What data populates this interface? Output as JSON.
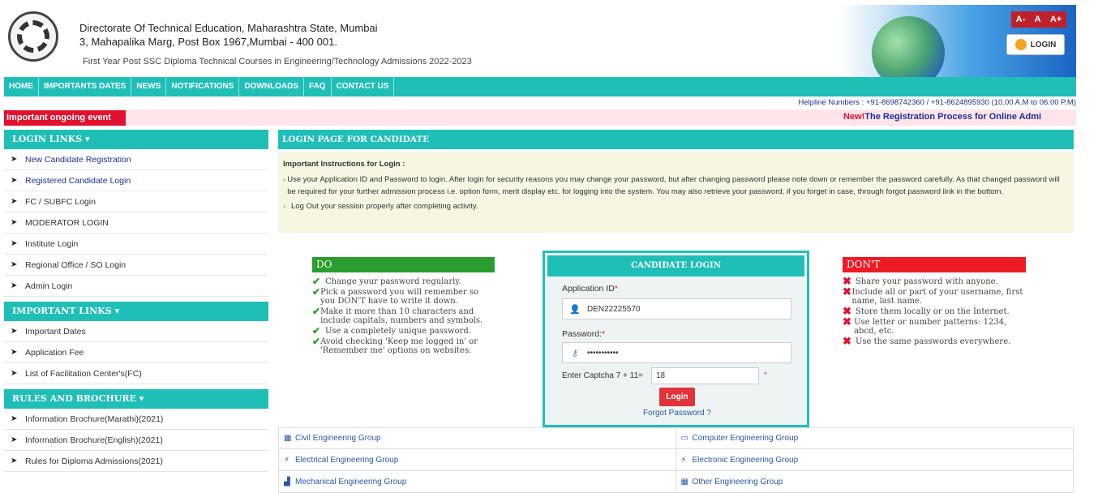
{
  "header": {
    "org_name": "Directorate Of Technical Education, Maharashtra State, Mumbai",
    "org_address": "3, Mahapalika Marg, Post Box 1967,Mumbai - 400 001.",
    "subtitle": "First Year Post SSC Diploma Technical Courses in Engineering/Technology Admissions 2022-2023",
    "font_controls": [
      "A-",
      "A",
      "A+"
    ],
    "login_label": "LOGIN"
  },
  "nav": [
    "HOME",
    "IMPORTANTS DATES",
    "NEWS",
    "NOTIFICATIONS",
    "DOWNLOADS",
    "FAQ",
    "CONTACT US"
  ],
  "helpline": "Helpline Numbers : +91-8698742360 / +91-8624895930   (10.00 A.M to 06.00 P.M)",
  "event": {
    "label": "Important ongoing event",
    "new_tag": "New!",
    "marquee": "The Registration Process for Online Admi"
  },
  "sidebar": {
    "login_links": {
      "title": "LOGIN LINKS ▾",
      "items": [
        "New Candidate Registration",
        "Registered Candidate Login",
        "FC / SUBFC Login",
        "MODERATOR LOGIN",
        "Institute Login",
        "Regional Office / SO Login",
        "Admin Login"
      ]
    },
    "important_links": {
      "title": "IMPORTANT LINKS ▾",
      "items": [
        "Important Dates",
        "Application Fee",
        "List of Facilitation Center's(FC)"
      ]
    },
    "rules": {
      "title": "RULES AND BROCHURE ▾",
      "items": [
        "Information Brochure(Marathi)(2021)",
        "Information Brochure(English)(2021)",
        "Rules for Diploma Admissions(2021)"
      ]
    }
  },
  "main": {
    "title": "LOGIN PAGE FOR CANDIDATE",
    "instructions_title": "Important Instructions for Login :",
    "instructions": [
      "Use your Application ID and Password to login. After login for security reasons you may change your password, but after changing password please note down or remember the password carefully. As that changed password will be required for your further admission process i.e. option form, merit display etc. for logging into the system. You may also retrieve your password, if you forget in case, through forgot password link in the bottom.",
      "Log Out your session properly after completing activity."
    ]
  },
  "do": {
    "title": "DO",
    "items": [
      "Change your password regularly.",
      "Pick a password you will remember so you DON'T have to write it down.",
      "Make it more than 10 characters and include capitals, numbers and symbols.",
      "Use a completely unique password.",
      "Avoid checking 'Keep me logged in' or 'Remember me' options on websites."
    ]
  },
  "dont": {
    "title": "DON'T",
    "items": [
      "Share your password with anyone.",
      "Include all or part of your username, first name, last name.",
      "Store them locally or on the Internet.",
      "Use letter or number patterns: 1234, abcd, etc.",
      "Use the same passwords everywhere."
    ]
  },
  "login_form": {
    "title": "CANDIDATE LOGIN",
    "app_id_label": "Application ID",
    "app_id_value": "DEN22225570",
    "password_label": "Password:",
    "password_value": "•••••••••••",
    "captcha_label": "Enter Captcha 7 + 11=",
    "captcha_value": "18",
    "required_mark": "*",
    "login_button": "Login",
    "forgot_link": "Forgot Password ?"
  },
  "groups": [
    [
      "Civil Engineering Group",
      "Computer Engineering Group"
    ],
    [
      "Electrical Engineering Group",
      "Electronic Engineering Group"
    ],
    [
      "Mechanical Engineering Group",
      "Other Engineering Group"
    ]
  ]
}
